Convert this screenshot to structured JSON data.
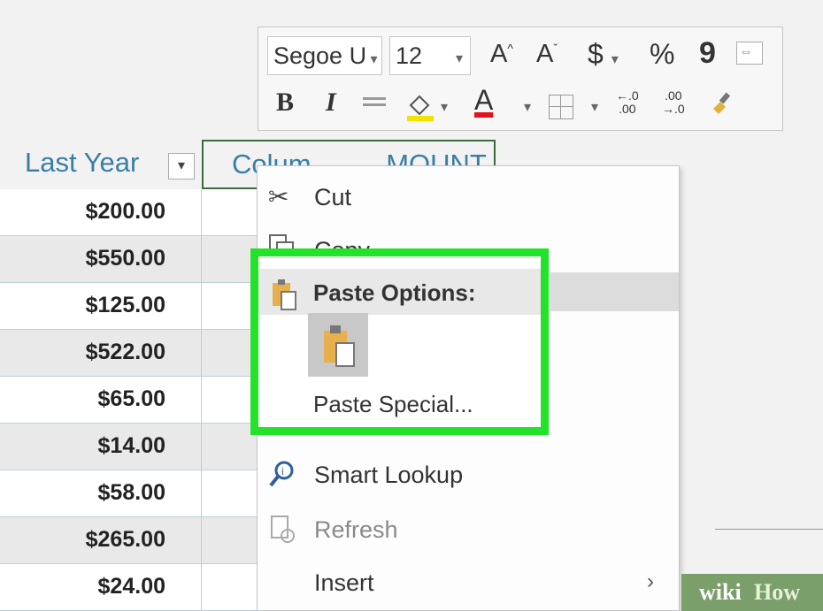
{
  "toolbar": {
    "font_name": "Segoe U",
    "font_size": "12",
    "grow_font": "A",
    "shrink_font": "A",
    "currency": "$",
    "percent": "%",
    "comma": "9",
    "bold": "B",
    "italic": "I",
    "font_color_letter": "A",
    "inc_decimal_top": "←.0",
    "inc_decimal_bottom": ".00",
    "dec_decimal_top": ".00",
    "dec_decimal_bottom": "→.0",
    "fill_color": "#f2e200",
    "font_color": "#e2111a"
  },
  "table": {
    "header_last_year": "Last Year",
    "header_column": "Colum",
    "header_amount": "MOUNT",
    "rows": [
      "$200.00",
      "$550.00",
      "$125.00",
      "$522.00",
      "$65.00",
      "$14.00",
      "$58.00",
      "$265.00",
      "$24.00"
    ]
  },
  "menu": {
    "cut": "Cut",
    "copy": "Copy",
    "paste_options": "Paste Options:",
    "paste_special": "Paste Special...",
    "smart_lookup": "Smart Lookup",
    "refresh": "Refresh",
    "insert": "Insert",
    "submenu_arrow": "›"
  },
  "highlight_color": "#22e22a",
  "watermark": {
    "part1": "wiki",
    "part2": "How"
  }
}
